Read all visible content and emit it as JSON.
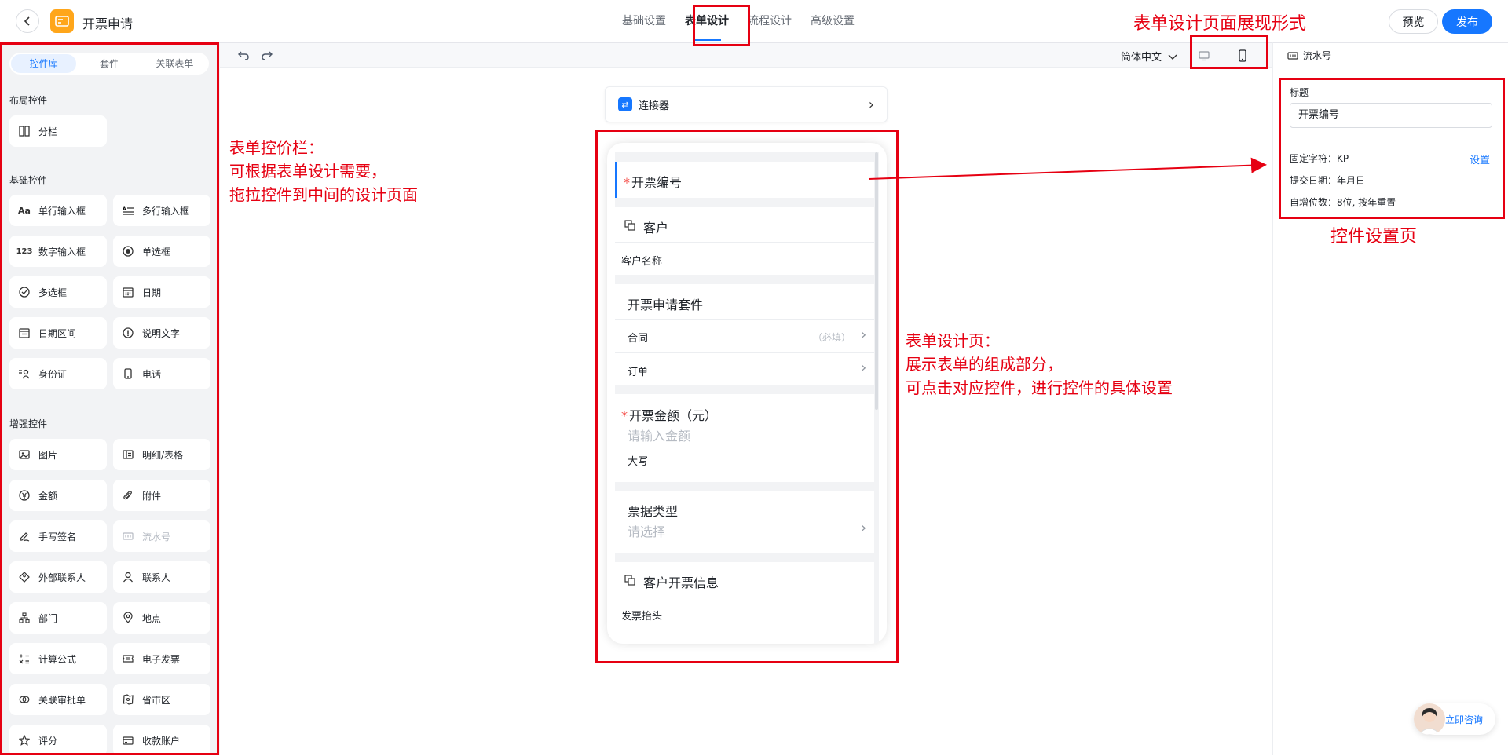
{
  "header": {
    "title": "开票申请",
    "tabs": [
      "基础设置",
      "表单设计",
      "流程设计",
      "高级设置"
    ],
    "active_tab": "表单设计",
    "preview_label": "预览",
    "publish_label": "发布"
  },
  "left_panel": {
    "tabs": [
      "控件库",
      "套件",
      "关联表单"
    ],
    "sections": {
      "layout": {
        "title": "布局控件",
        "items": [
          "分栏"
        ]
      },
      "basic": {
        "title": "基础控件",
        "items": [
          "单行输入框",
          "多行输入框",
          "数字输入框",
          "单选框",
          "多选框",
          "日期",
          "日期区间",
          "说明文字",
          "身份证",
          "电话"
        ]
      },
      "enhanced": {
        "title": "增强控件",
        "items": [
          "图片",
          "明细/表格",
          "金额",
          "附件",
          "手写签名",
          "流水号",
          "外部联系人",
          "联系人",
          "部门",
          "地点",
          "计算公式",
          "电子发票",
          "关联审批单",
          "省市区",
          "评分",
          "收款账户"
        ]
      }
    }
  },
  "toolbar": {
    "language": "简体中文"
  },
  "canvas": {
    "connector_label": "连接器",
    "fields": {
      "invoice_number": "开票编号",
      "customer_suite": "客户",
      "customer_name": "客户名称",
      "suite_title": "开票申请套件",
      "contract": "合同",
      "contract_hint": "（必填）",
      "order": "订单",
      "amount_title": "开票金额（元）",
      "amount_placeholder": "请输入金额",
      "amount_caps": "大写",
      "bill_type": "票据类型",
      "bill_type_placeholder": "请选择",
      "customer_invoice_info": "客户开票信息",
      "invoice_header": "发票抬头"
    }
  },
  "right_panel": {
    "header": "流水号",
    "title_label": "标题",
    "title_value": "开票编号",
    "fixed_chars": "固定字符：KP",
    "submit_date": "提交日期：年月日",
    "increment": "自增位数：8位, 按年重置",
    "settings_link": "设置"
  },
  "annotations": {
    "left_line1": "表单控价栏：",
    "left_line2": "可根据表单设计需要，",
    "left_line3": "拖拉控件到中间的设计页面",
    "center_line1": "表单设计页：",
    "center_line2": "展示表单的组成部分，",
    "center_line3": "可点击对应控件，进行控件的具体设置",
    "top_right": "表单设计页面展现形式",
    "right": "控件设置页"
  },
  "consult_label": "立即咨询",
  "colors": {
    "primary": "#1677ff",
    "annotation_red": "#e60012",
    "app_icon": "#ffa61a"
  }
}
